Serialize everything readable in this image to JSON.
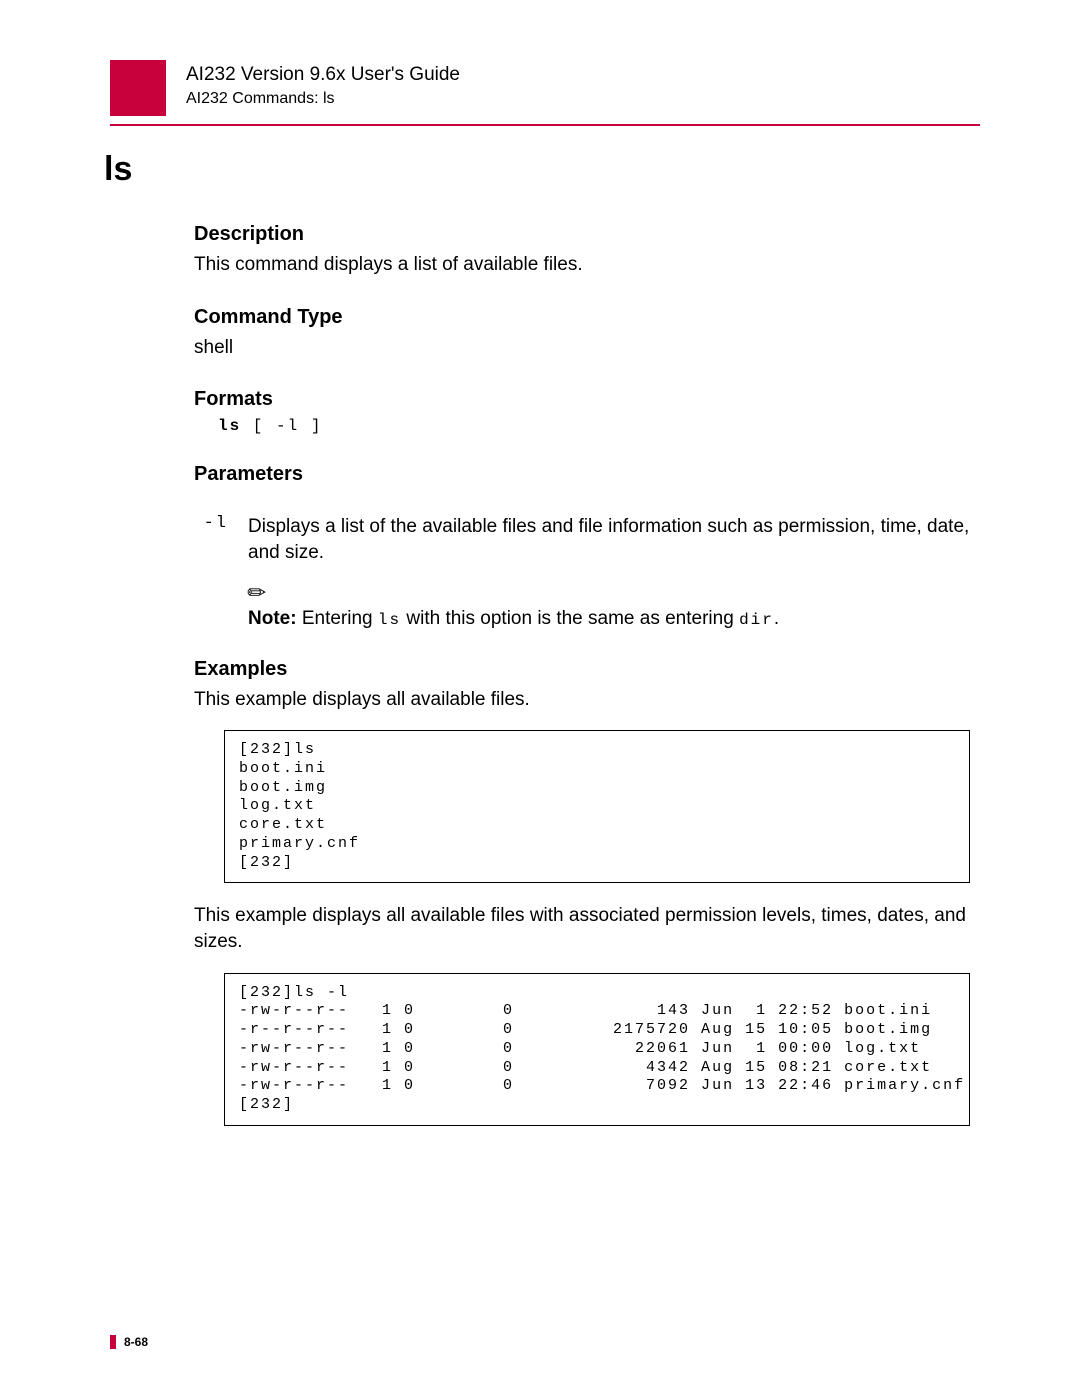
{
  "header": {
    "guide_title": "AI232 Version 9.6x User's Guide",
    "breadcrumb": "AI232 Commands: ls"
  },
  "command_title": "ls",
  "sections": {
    "description": {
      "head": "Description",
      "body": "This command displays a list of available files."
    },
    "command_type": {
      "head": "Command Type",
      "body": "shell"
    },
    "formats": {
      "head": "Formats",
      "cmd": "ls",
      "args": " [ -l ]"
    },
    "parameters": {
      "head": "Parameters",
      "flag": "-l",
      "desc": "Displays a list of the available files and file information such as permission, time, date, and size."
    },
    "note": {
      "label": "Note:",
      "pre": "  Entering ",
      "cmd1": "ls",
      "mid": " with this option is the same as entering ",
      "cmd2": "dir",
      "post": "."
    },
    "examples": {
      "head": "Examples",
      "intro1": "This example displays all available files.",
      "code1": "[232]ls\nboot.ini\nboot.img\nlog.txt\ncore.txt\nprimary.cnf\n[232]",
      "intro2": "This example displays all available files with associated permission levels, times, dates, and sizes.",
      "code2": "[232]ls -l\n-rw-r--r--   1 0        0             143 Jun  1 22:52 boot.ini\n-r--r--r--   1 0        0         2175720 Aug 15 10:05 boot.img\n-rw-r--r--   1 0        0           22061 Jun  1 00:00 log.txt\n-rw-r--r--   1 0        0            4342 Aug 15 08:21 core.txt\n-rw-r--r--   1 0        0            7092 Jun 13 22:46 primary.cnf\n[232]"
    }
  },
  "footer": {
    "page": "8-68"
  }
}
